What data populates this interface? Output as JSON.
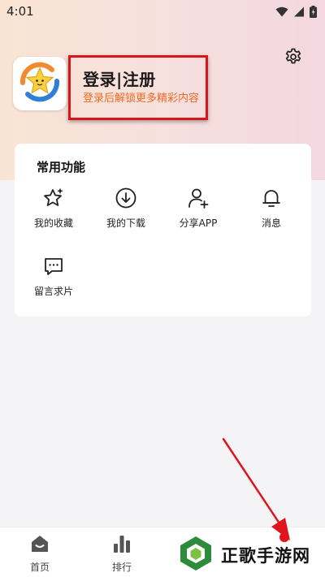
{
  "status_bar": {
    "time": "4:01",
    "icons": [
      "wifi-icon",
      "signal-icon",
      "battery-icon"
    ]
  },
  "profile": {
    "title": "登录|注册",
    "subtitle": "登录后解锁更多精彩内容",
    "avatar_icon": "star-logo-icon",
    "settings_icon": "gear-icon"
  },
  "common_functions": {
    "title": "常用功能",
    "items": [
      {
        "label": "我的收藏",
        "icon": "star-sparkle-icon"
      },
      {
        "label": "我的下载",
        "icon": "download-icon"
      },
      {
        "label": "分享APP",
        "icon": "user-add-icon"
      },
      {
        "label": "消息",
        "icon": "bell-icon"
      },
      {
        "label": "留言求片",
        "icon": "message-icon"
      }
    ]
  },
  "bottom_nav": {
    "items": [
      {
        "label": "首页",
        "icon": "home-icon"
      },
      {
        "label": "排行",
        "icon": "ranking-icon"
      }
    ]
  },
  "watermark": {
    "text": "正歌手游网"
  },
  "colors": {
    "accent_orange": "#f06a22",
    "highlight_red": "#d8151b",
    "background": "#f4f4f6"
  }
}
